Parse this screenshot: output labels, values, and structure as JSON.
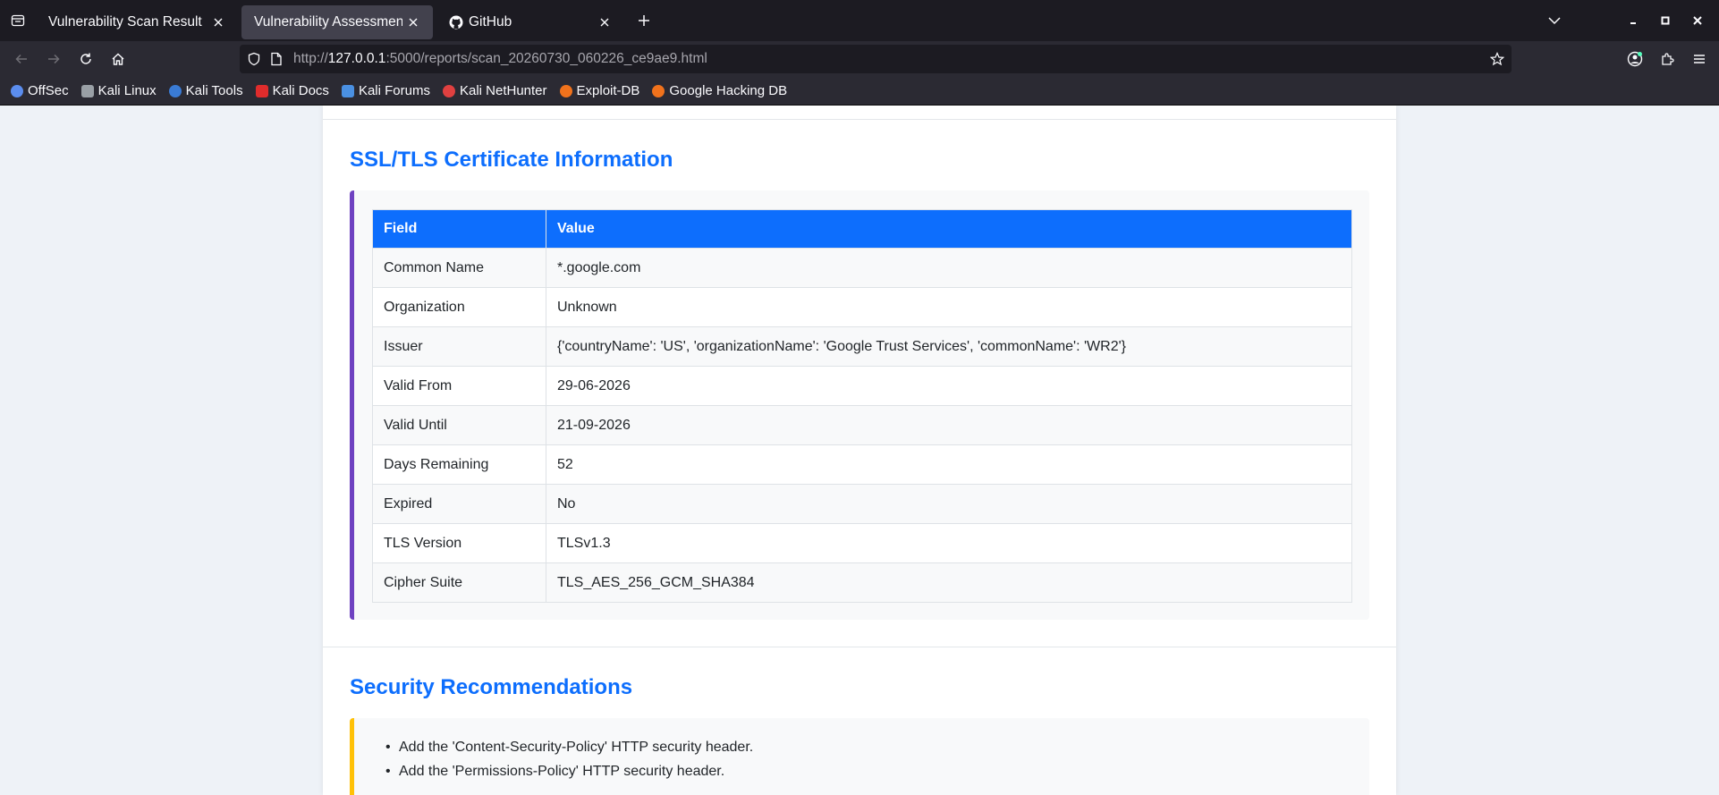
{
  "browser": {
    "tabs": [
      {
        "title": "Vulnerability Scan Result",
        "active": false
      },
      {
        "title": "Vulnerability Assessment Report",
        "active": true
      },
      {
        "title": "GitHub",
        "active": false
      }
    ],
    "url": {
      "prefix": "http://",
      "host": "127.0.0.1",
      "path": ":5000/reports/scan_20260730_060226_ce9ae9.html"
    },
    "bookmarks": [
      {
        "label": "OffSec",
        "color": "#5b8def"
      },
      {
        "label": "Kali Linux",
        "color": "#9aa0a6"
      },
      {
        "label": "Kali Tools",
        "color": "#3a7bd5"
      },
      {
        "label": "Kali Docs",
        "color": "#e02c2c"
      },
      {
        "label": "Kali Forums",
        "color": "#4a90e2"
      },
      {
        "label": "Kali NetHunter",
        "color": "#e04040"
      },
      {
        "label": "Exploit-DB",
        "color": "#f0721c"
      },
      {
        "label": "Google Hacking DB",
        "color": "#f0721c"
      }
    ]
  },
  "report": {
    "ssl_title": "SSL/TLS Certificate Information",
    "table": {
      "headers": [
        "Field",
        "Value"
      ],
      "rows": [
        [
          "Common Name",
          "*.google.com"
        ],
        [
          "Organization",
          "Unknown"
        ],
        [
          "Issuer",
          "{'countryName': 'US', 'organizationName': 'Google Trust Services', 'commonName': 'WR2'}"
        ],
        [
          "Valid From",
          "29-06-2026"
        ],
        [
          "Valid Until",
          "21-09-2026"
        ],
        [
          "Days Remaining",
          "52"
        ],
        [
          "Expired",
          "No"
        ],
        [
          "TLS Version",
          "TLSv1.3"
        ],
        [
          "Cipher Suite",
          "TLS_AES_256_GCM_SHA384"
        ]
      ]
    },
    "rec_title": "Security Recommendations",
    "recommendations": [
      "Add the 'Content-Security-Policy' HTTP security header.",
      "Add the 'Permissions-Policy' HTTP security header."
    ]
  }
}
